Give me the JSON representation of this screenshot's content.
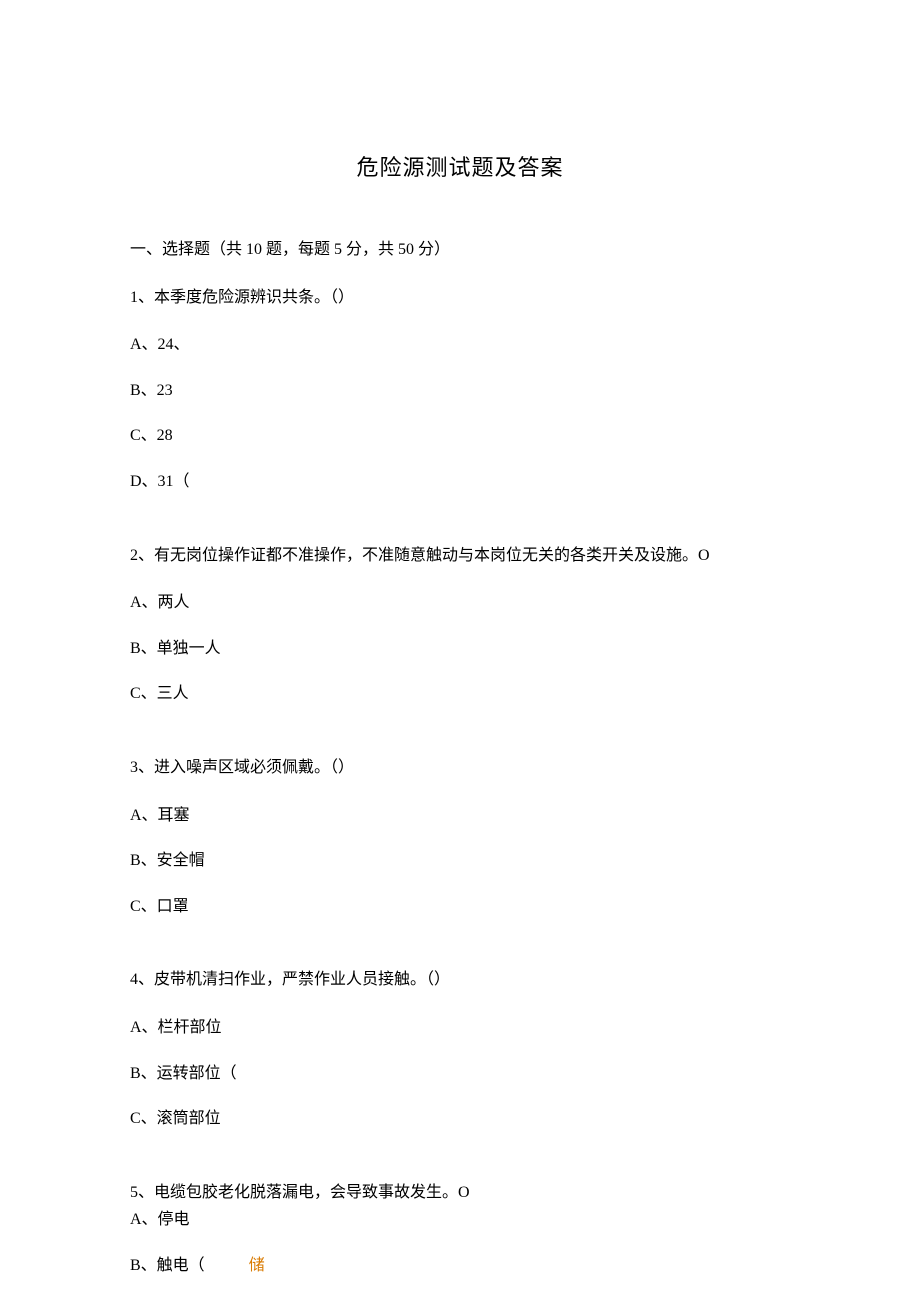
{
  "title": "危险源测试题及答案",
  "section_header": "一、选择题（共 10 题，每题 5 分，共 50 分）",
  "q1": {
    "stem": "1、本季度危险源辨识共条。（）",
    "a": "A、24、",
    "b": "B、23",
    "c": "C、28",
    "d": "D、31（"
  },
  "q2": {
    "stem": "2、有无岗位操作证都不准操作，不准随意触动与本岗位无关的各类开关及设施。O",
    "a": "A、两人",
    "b": "B、单独一人",
    "c": "C、三人"
  },
  "q3": {
    "stem": "3、进入噪声区域必须佩戴。（）",
    "a": "A、耳塞",
    "b": "B、安全帽",
    "c": "C、口罩"
  },
  "q4": {
    "stem": "4、皮带机清扫作业，严禁作业人员接触。（）",
    "a": "A、栏杆部位",
    "b": "B、运转部位（",
    "c": "C、滚筒部位"
  },
  "q5": {
    "stem": "5、电缆包胶老化脱落漏电，会导致事故发生。O",
    "a": "A、停电",
    "b": "B、触电（",
    "b_extra": "储"
  }
}
